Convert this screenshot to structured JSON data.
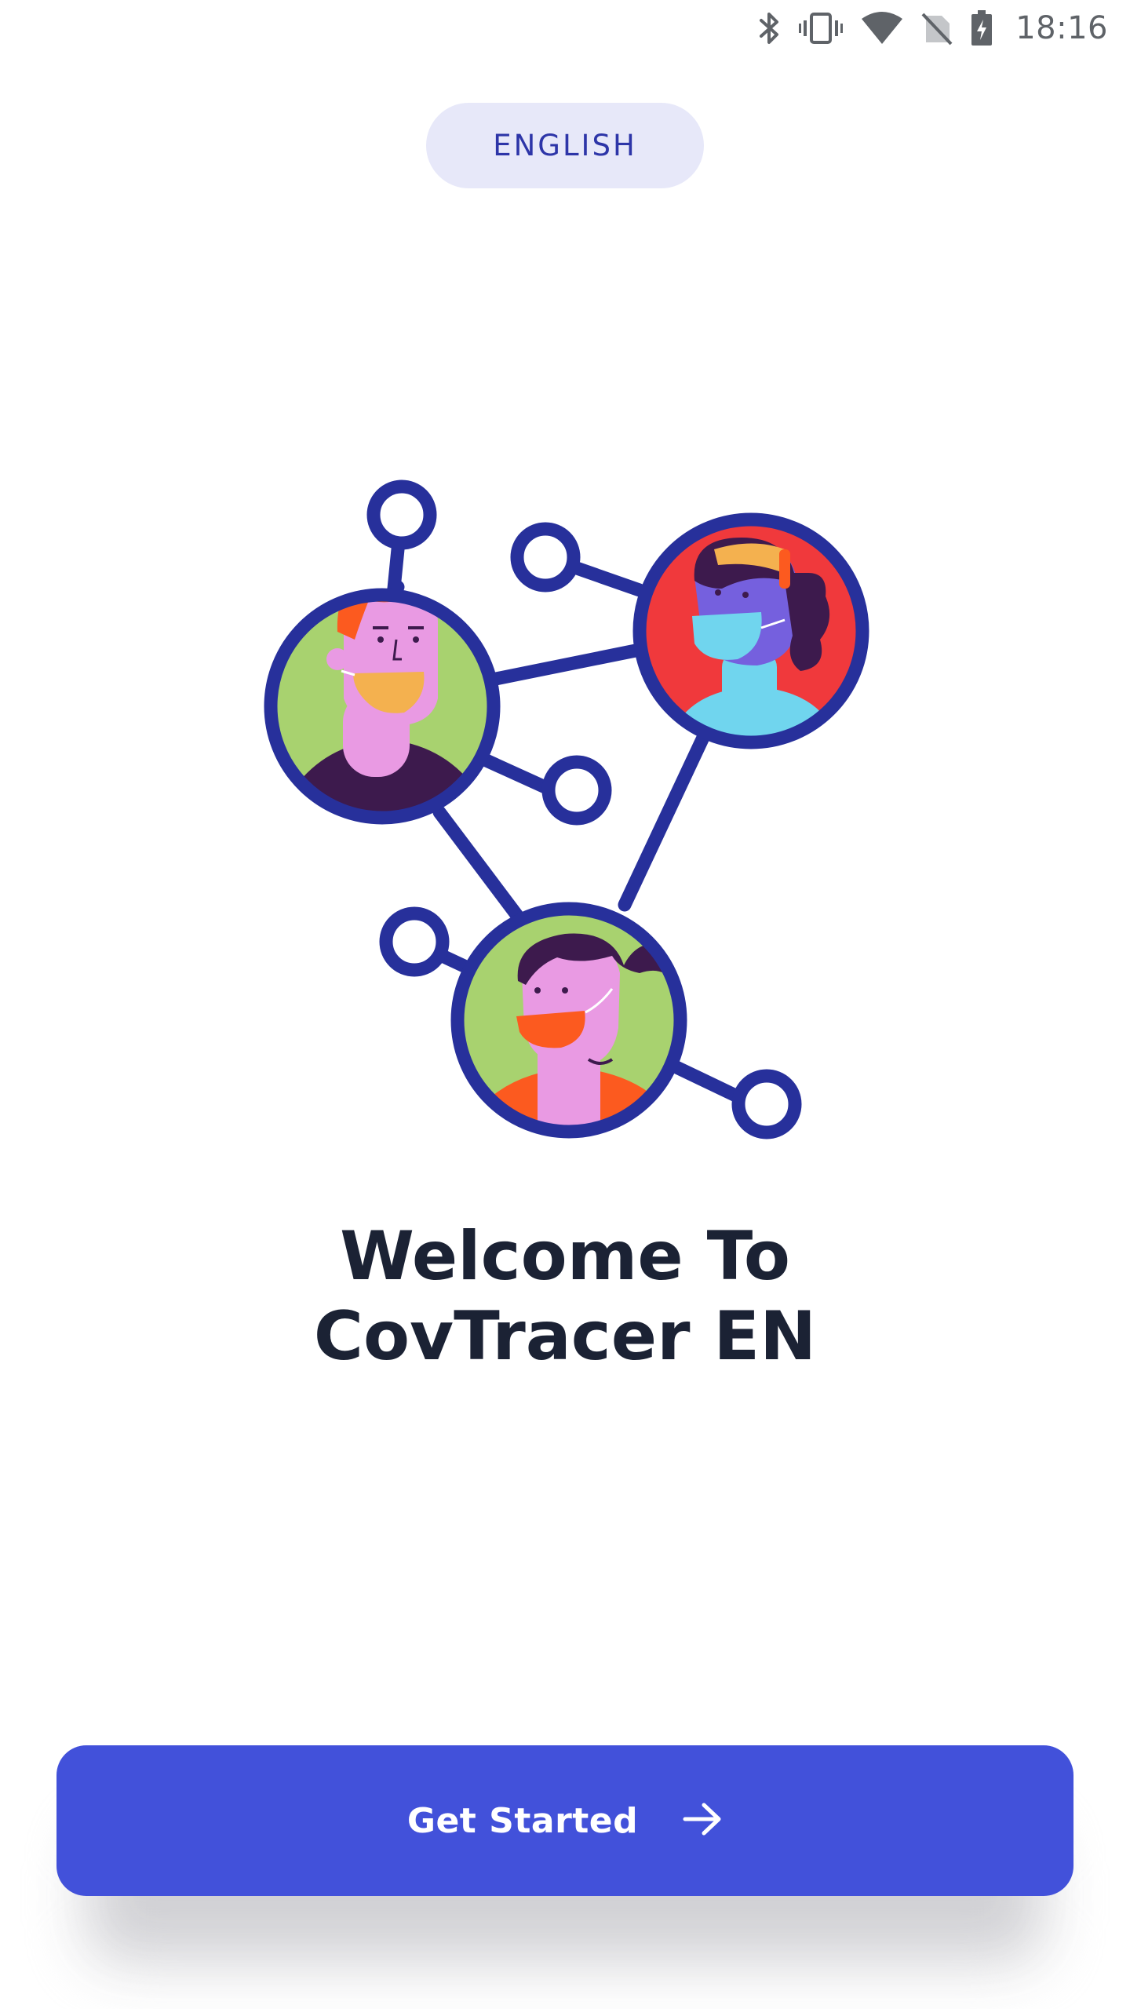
{
  "status_bar": {
    "time": "18:16",
    "icons": [
      "bluetooth-icon",
      "vibrate-icon",
      "wifi-icon",
      "no-sim-icon",
      "battery-charging-icon"
    ]
  },
  "language": {
    "label": "ENGLISH"
  },
  "illustration": {
    "name": "network-of-masked-people",
    "colors": {
      "outline": "#27309b",
      "green": "#a8d26f",
      "red": "#f0393c",
      "skin_pink": "#e99ae3",
      "purple_skin": "#7560de",
      "mask_orange": "#f4b14f",
      "mask_cyan": "#70d5ee",
      "mask_red_orange": "#fc5a1f",
      "hair_orange": "#fc5a1f",
      "hair_dark": "#3d1a4d"
    }
  },
  "welcome": {
    "line1": "Welcome To",
    "line2": "CovTracer EN"
  },
  "cta": {
    "label": "Get Started",
    "icon": "arrow-right-icon",
    "color": "#4251da"
  }
}
